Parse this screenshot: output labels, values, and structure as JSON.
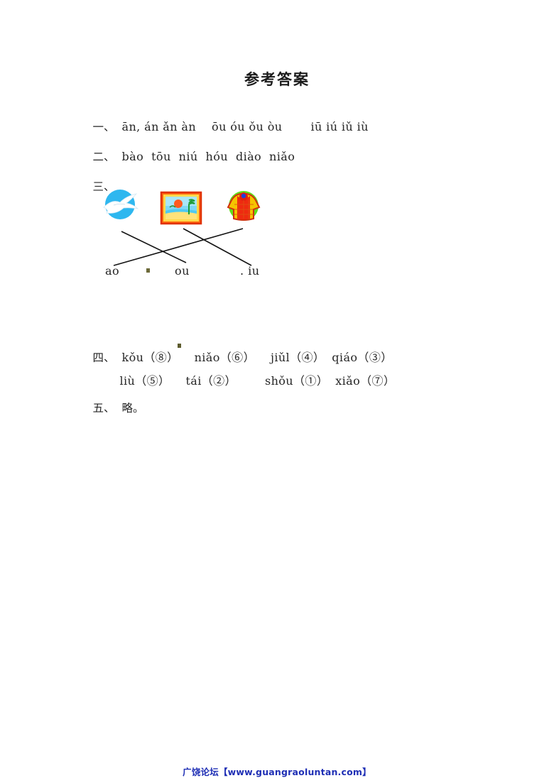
{
  "document": {
    "title": "参考答案"
  },
  "sections": {
    "one": {
      "marker": "一、",
      "group_a": "ān, án ǎn àn",
      "group_b": "ōu óu ǒu òu",
      "group_c": "iū iú iǔ iù"
    },
    "two": {
      "marker": "二、",
      "answers": "bào  tōu  niú  hóu  diào  niǎo"
    },
    "three": {
      "marker": "三、",
      "labels": {
        "left": "ao",
        "middle": "ou",
        "right": ". iu"
      },
      "pictures": [
        {
          "name": "flying-bird",
          "alt": "white bird flying on blue circle"
        },
        {
          "name": "beach-picture-frame",
          "alt": "framed beach sunset picture"
        },
        {
          "name": "checkered-coat",
          "alt": "red and yellow checkered coat on green circle"
        }
      ],
      "connections": [
        {
          "from": "flying-bird",
          "to": "ou"
        },
        {
          "from": "beach-picture-frame",
          "to": "iu"
        },
        {
          "from": "checkered-coat",
          "to": "ao"
        }
      ]
    },
    "four": {
      "marker": "四、",
      "row_one": [
        {
          "word": "kǒu",
          "number": "（⑧）"
        },
        {
          "word": "niǎo",
          "number": "（⑥）"
        },
        {
          "word": "jiǔl",
          "number": "（④）"
        },
        {
          "word": "qiáo",
          "number": "（③）"
        }
      ],
      "row_two": [
        {
          "word": "liù",
          "number": "（⑤）"
        },
        {
          "word": "tái",
          "number": "（②）"
        },
        {
          "word": "shǒu",
          "number": "（①）"
        },
        {
          "word": "xiǎo",
          "number": "（⑦）"
        }
      ]
    },
    "five": {
      "marker": "五、",
      "answer": "略。"
    }
  },
  "footer": {
    "watermark": "广饶论坛【www.guangraoluntan.com】",
    "color": "#1f2fb5"
  }
}
